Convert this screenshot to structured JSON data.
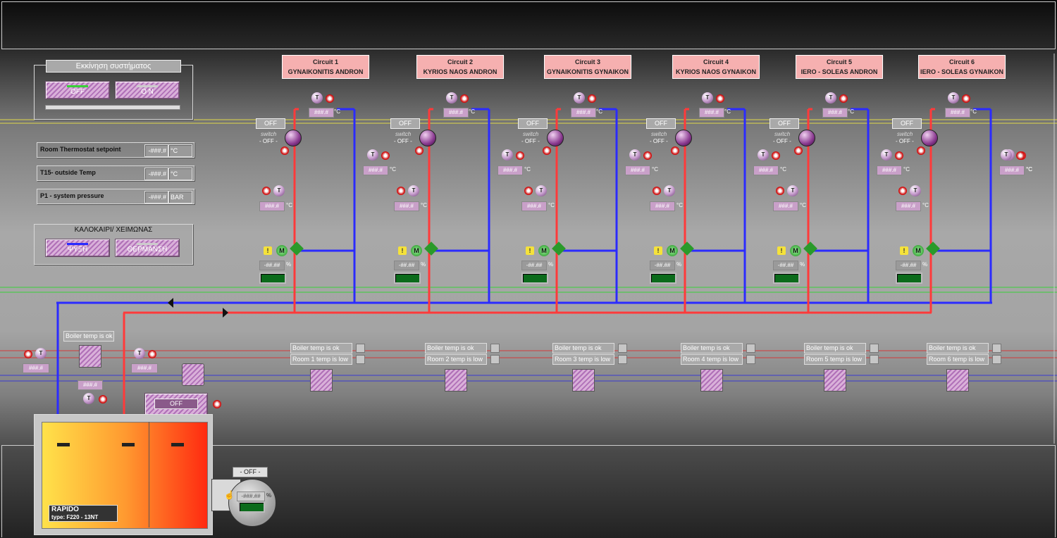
{
  "startup": {
    "title": "Εκκίνηση συστήματος",
    "off": "OFF",
    "on": "O N"
  },
  "readouts": [
    {
      "label": "Room Thermostat setpoint",
      "value": "-###.#",
      "unit": "°C"
    },
    {
      "label": "T15- outside Temp",
      "value": "-###.#",
      "unit": "°C"
    },
    {
      "label": "P1 - system pressure",
      "value": "-###.#",
      "unit": "BAR"
    }
  ],
  "season": {
    "title": "ΚΑΛΟΚΑΙΡΙ/ ΧΕΙΜΩΝΑΣ",
    "cool": "ΨΥΞΗ",
    "heat": "ΘΕΡΜΑΝΣΗ"
  },
  "circuits": [
    {
      "title": "Circuit 1",
      "name": "GYNAIKONITIS ANDRON",
      "status1": "Boiler temp is ok",
      "status2": "Room 1 temp is low"
    },
    {
      "title": "Circuit 2",
      "name": "KYRIOS NAOS ANDRON",
      "status1": "Boiler temp is ok",
      "status2": "Room 2 temp is low"
    },
    {
      "title": "Circuit 3",
      "name": "GYNAIKONITIS GYNAIKON",
      "status1": "Boiler temp is ok",
      "status2": "Room 3 temp is low"
    },
    {
      "title": "Circuit 4",
      "name": "KYRIOS NAOS GYNAIKON",
      "status1": "Boiler temp is ok",
      "status2": "Room 4 temp is low"
    },
    {
      "title": "Circuit 5",
      "name": "IERO - SOLEAS ANDRON",
      "status1": "Boiler temp is ok",
      "status2": "Room 5 temp is low"
    },
    {
      "title": "Circuit 6",
      "name": "IERO - SOLEAS GYNAIKON",
      "status1": "Boiler temp is ok",
      "status2": "Room 6 temp is low"
    }
  ],
  "common": {
    "off": "OFF",
    "switch": "switch",
    "switch_state": "- OFF -",
    "temp": "###.#",
    "unit_c": "°C",
    "pct": "-##.##",
    "unit_pct": "%",
    "t": "T",
    "m": "M"
  },
  "boiler": {
    "status": "Boiler temp is ok",
    "temp": "###.#",
    "off": "OFF",
    "name": "RAPIDO",
    "type": "type: F220 - 13NT"
  },
  "burner": {
    "state": "- OFF -",
    "value": "-###.##",
    "unit": "%"
  },
  "colors": {
    "hot": "#ff3a3a",
    "cold": "#2b2bff",
    "accent": "#f6b0b0"
  }
}
